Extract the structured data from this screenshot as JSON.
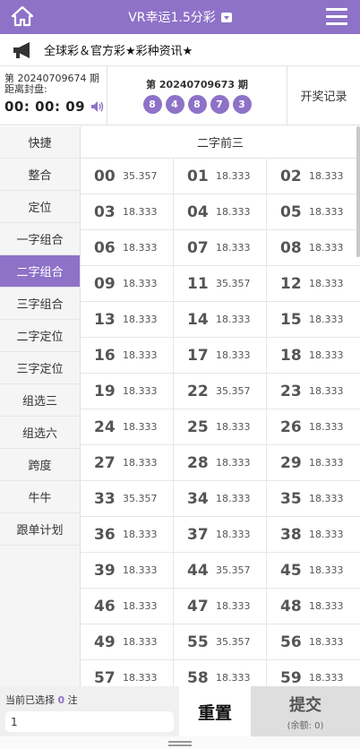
{
  "header": {
    "title": "VR幸运1.5分彩",
    "home_icon": "home-icon",
    "menu_icon": "hamburger-menu-icon"
  },
  "notice": {
    "icon": "megaphone-icon",
    "text": "全球彩＆官方彩★彩种资讯★"
  },
  "current": {
    "issue": "第 20240709674 期",
    "label": "距离封盘:",
    "countdown": "00: 00: 09",
    "sound_icon": "speaker-icon"
  },
  "last": {
    "issue": "第 20240709673 期",
    "balls": [
      "8",
      "4",
      "8",
      "7",
      "3"
    ]
  },
  "history_label": "开奖记录",
  "sidebar": {
    "items": [
      "快捷",
      "整合",
      "定位",
      "一字组合",
      "二字组合",
      "三字组合",
      "二字定位",
      "三字定位",
      "组选三",
      "组选六",
      "跨度",
      "牛牛",
      "跟单计划"
    ],
    "active_index": 4
  },
  "main": {
    "title": "二字前三",
    "cells": [
      {
        "num": "00",
        "odds": "35.357"
      },
      {
        "num": "01",
        "odds": "18.333"
      },
      {
        "num": "02",
        "odds": "18.333"
      },
      {
        "num": "03",
        "odds": "18.333"
      },
      {
        "num": "04",
        "odds": "18.333"
      },
      {
        "num": "05",
        "odds": "18.333"
      },
      {
        "num": "06",
        "odds": "18.333"
      },
      {
        "num": "07",
        "odds": "18.333"
      },
      {
        "num": "08",
        "odds": "18.333"
      },
      {
        "num": "09",
        "odds": "18.333"
      },
      {
        "num": "11",
        "odds": "35.357"
      },
      {
        "num": "12",
        "odds": "18.333"
      },
      {
        "num": "13",
        "odds": "18.333"
      },
      {
        "num": "14",
        "odds": "18.333"
      },
      {
        "num": "15",
        "odds": "18.333"
      },
      {
        "num": "16",
        "odds": "18.333"
      },
      {
        "num": "17",
        "odds": "18.333"
      },
      {
        "num": "18",
        "odds": "18.333"
      },
      {
        "num": "19",
        "odds": "18.333"
      },
      {
        "num": "22",
        "odds": "35.357"
      },
      {
        "num": "23",
        "odds": "18.333"
      },
      {
        "num": "24",
        "odds": "18.333"
      },
      {
        "num": "25",
        "odds": "18.333"
      },
      {
        "num": "26",
        "odds": "18.333"
      },
      {
        "num": "27",
        "odds": "18.333"
      },
      {
        "num": "28",
        "odds": "18.333"
      },
      {
        "num": "29",
        "odds": "18.333"
      },
      {
        "num": "33",
        "odds": "35.357"
      },
      {
        "num": "34",
        "odds": "18.333"
      },
      {
        "num": "35",
        "odds": "18.333"
      },
      {
        "num": "36",
        "odds": "18.333"
      },
      {
        "num": "37",
        "odds": "18.333"
      },
      {
        "num": "38",
        "odds": "18.333"
      },
      {
        "num": "39",
        "odds": "18.333"
      },
      {
        "num": "44",
        "odds": "35.357"
      },
      {
        "num": "45",
        "odds": "18.333"
      },
      {
        "num": "46",
        "odds": "18.333"
      },
      {
        "num": "47",
        "odds": "18.333"
      },
      {
        "num": "48",
        "odds": "18.333"
      },
      {
        "num": "49",
        "odds": "18.333"
      },
      {
        "num": "55",
        "odds": "35.357"
      },
      {
        "num": "56",
        "odds": "18.333"
      },
      {
        "num": "57",
        "odds": "18.333"
      },
      {
        "num": "58",
        "odds": "18.333"
      },
      {
        "num": "59",
        "odds": "18.333"
      }
    ]
  },
  "footer": {
    "selected_prefix": "当前已选择",
    "selected_count": "0",
    "selected_suffix": "注",
    "amount_value": "1",
    "reset_label": "重置",
    "submit_label": "提交",
    "balance_label": "(余额: 0)"
  },
  "colors": {
    "accent": "#8e72c8"
  }
}
